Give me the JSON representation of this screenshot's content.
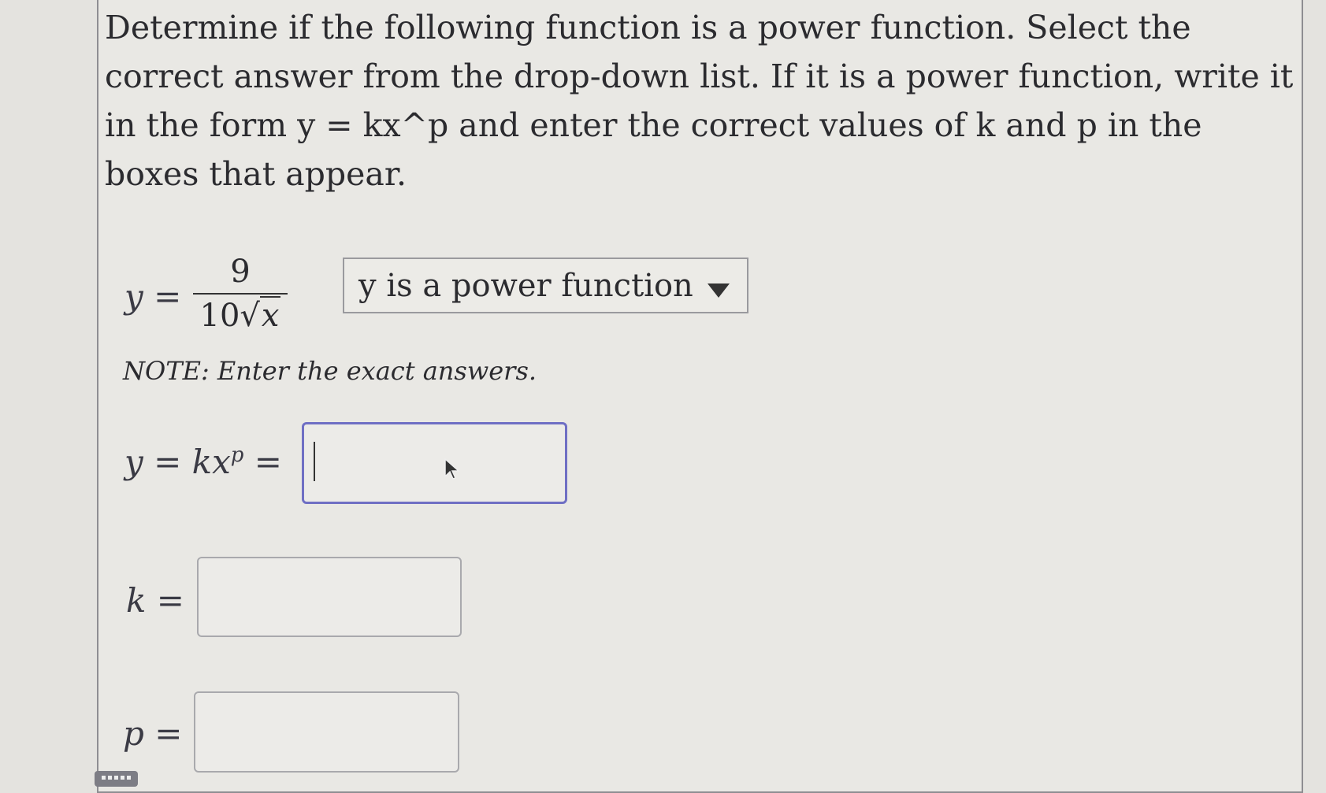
{
  "question": {
    "text": "Determine if the following function is a power function. Select the correct answer from the drop-down list. If it is a power function, write it in the form y = kx^p and enter the correct values of k and p in the boxes that appear."
  },
  "equation": {
    "lhs": "y =",
    "numerator": "9",
    "denominator_coef": "10",
    "radicand": "x"
  },
  "dropdown": {
    "selected": "y is a power function"
  },
  "note": "NOTE: Enter the exact answers.",
  "fields": [
    {
      "label": "y = kx",
      "sup": "p",
      "suffix": " =",
      "value": ""
    },
    {
      "label": "k =",
      "value": ""
    },
    {
      "label": "p =",
      "value": ""
    }
  ],
  "icons": {
    "dropdown": "triangle-down",
    "keyboard": "keyboard-icon",
    "pointer": "mouse-cursor"
  }
}
